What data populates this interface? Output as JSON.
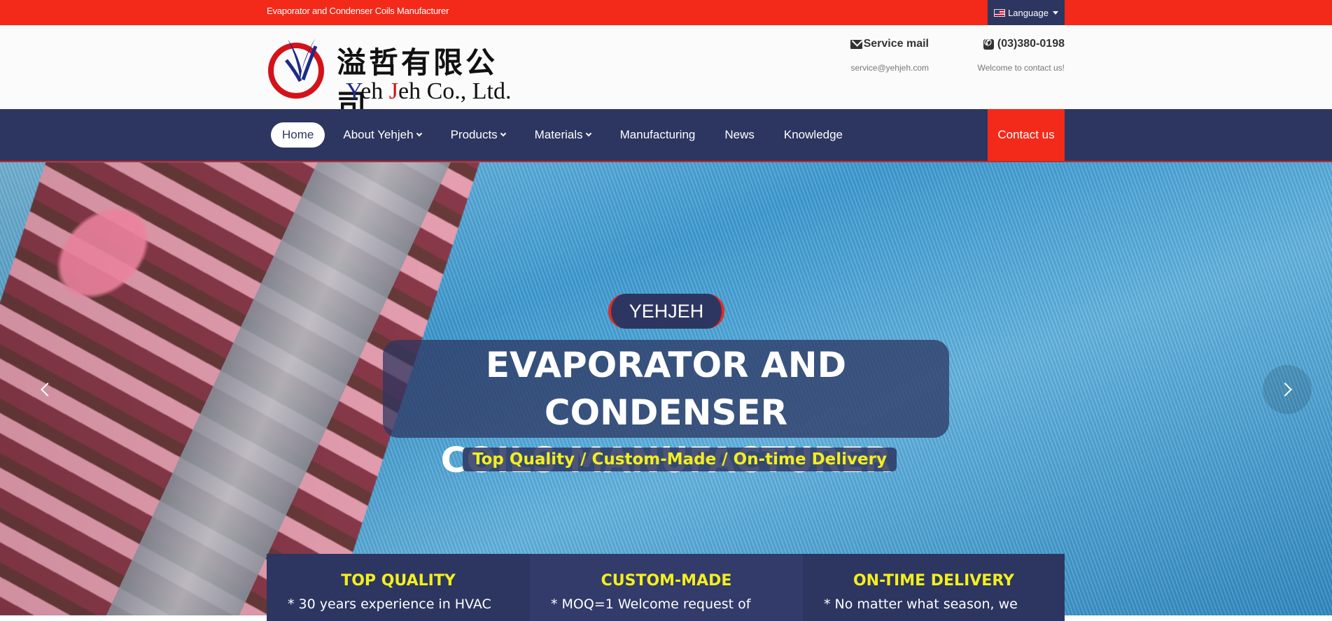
{
  "topbar": {
    "tagline": "Evaporator and Condenser Coils Manufacturer",
    "language_label": "Language"
  },
  "header": {
    "logo_cn": "溢哲有限公司",
    "logo_en": {
      "y": "Y",
      "eh": "eh ",
      "j": "J",
      "rest": "eh Co., Ltd."
    },
    "mail_title": "Service mail",
    "mail_sub": "service@yehjeh.com",
    "phone_title": "(03)380-0198",
    "phone_sub": "Welcome to contact us!"
  },
  "nav": {
    "items": [
      {
        "label": "Home",
        "active": true,
        "dropdown": false
      },
      {
        "label": "About Yehjeh",
        "dropdown": true
      },
      {
        "label": "Products",
        "dropdown": true
      },
      {
        "label": "Materials",
        "dropdown": true
      },
      {
        "label": "Manufacturing",
        "dropdown": false
      },
      {
        "label": "News",
        "dropdown": false
      },
      {
        "label": "Knowledge",
        "dropdown": false
      }
    ],
    "contact_label": "Contact us"
  },
  "hero": {
    "badge": "YEHJEH",
    "headline_line1": "EVAPORATOR AND CONDENSER",
    "headline_line2": "COILS MANUFACTURER",
    "tagline": "Top Quality / Custom-Made / On-time Delivery"
  },
  "features": [
    {
      "title": "TOP QUALITY",
      "text": "* 30 years experience in HVAC"
    },
    {
      "title": "CUSTOM-MADE",
      "text": "* MOQ=1 Welcome request of"
    },
    {
      "title": "ON-TIME DELIVERY",
      "text": "* No matter what season, we"
    }
  ],
  "colors": {
    "brand_red": "#f32a1a",
    "navy": "#2d3660",
    "accent_yellow": "#f3ef1d"
  },
  "icons": {
    "flag": "us-flag-icon",
    "mail": "envelope-icon",
    "phone": "phone-icon",
    "prev": "chevron-left-icon",
    "next": "chevron-right-icon"
  }
}
